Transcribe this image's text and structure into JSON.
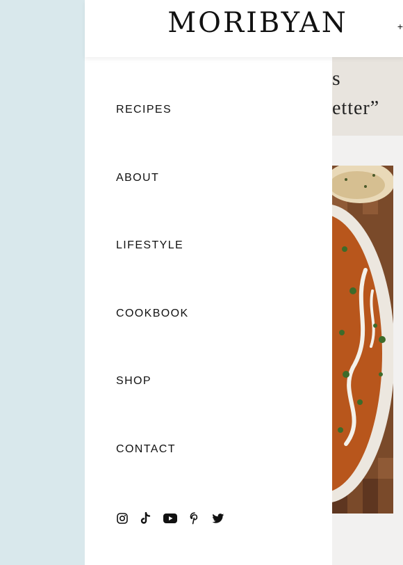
{
  "header": {
    "logo_text": "MORIBYAN",
    "edge_glyph": "+"
  },
  "banner": {
    "fragment_line1": "s",
    "fragment_line2": "etter”"
  },
  "drawer": {
    "menu_items": [
      {
        "label": "RECIPES"
      },
      {
        "label": "ABOUT"
      },
      {
        "label": "LIFESTYLE"
      },
      {
        "label": "COOKBOOK"
      },
      {
        "label": "SHOP"
      },
      {
        "label": "CONTACT"
      }
    ],
    "social_icons": [
      "instagram-icon",
      "tiktok-icon",
      "youtube-icon",
      "pinterest-icon",
      "twitter-icon"
    ]
  },
  "colors": {
    "left_strip": "#d9e8ec",
    "page_background": "#f2f1f0",
    "quote_band": "#e8e4de",
    "text": "#111111"
  }
}
